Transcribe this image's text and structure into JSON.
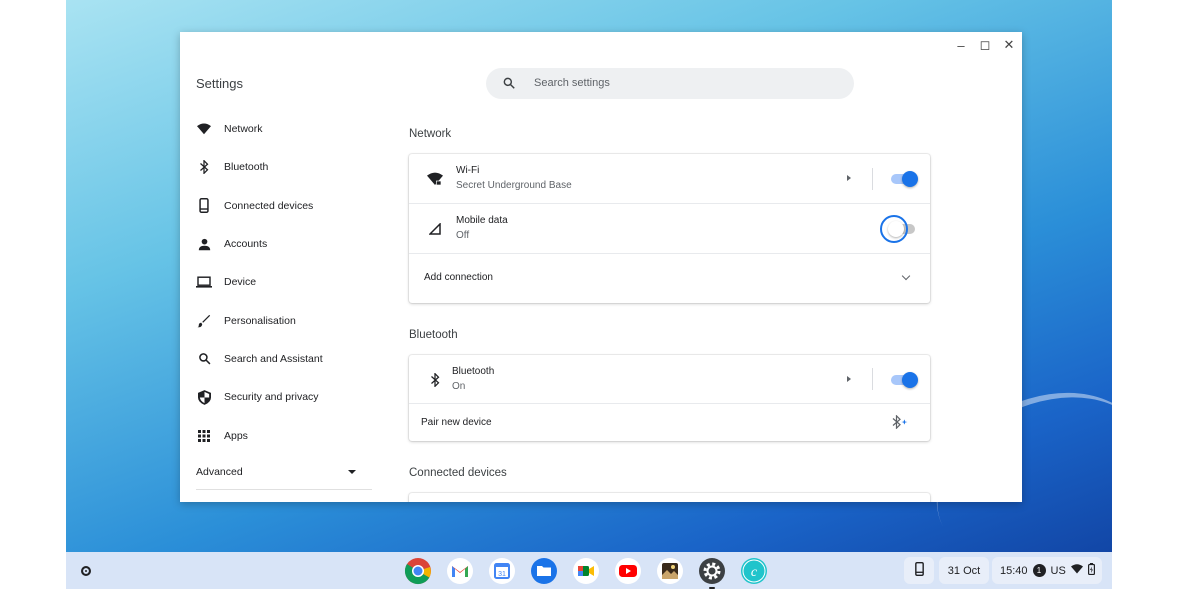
{
  "window": {
    "title": "Settings",
    "search_placeholder": "Search settings"
  },
  "sidebar": {
    "items": [
      {
        "label": "Network",
        "icon": "wifi-icon"
      },
      {
        "label": "Bluetooth",
        "icon": "bluetooth-icon"
      },
      {
        "label": "Connected devices",
        "icon": "phone-icon"
      },
      {
        "label": "Accounts",
        "icon": "person-icon"
      },
      {
        "label": "Device",
        "icon": "laptop-icon"
      },
      {
        "label": "Personalisation",
        "icon": "brush-icon"
      },
      {
        "label": "Search and Assistant",
        "icon": "search-icon"
      },
      {
        "label": "Security and privacy",
        "icon": "shield-icon"
      },
      {
        "label": "Apps",
        "icon": "apps-grid-icon"
      }
    ],
    "advanced_label": "Advanced"
  },
  "network": {
    "section_title": "Network",
    "wifi": {
      "title": "Wi-Fi",
      "subtitle": "Secret Underground Base",
      "enabled": true
    },
    "mobile": {
      "title": "Mobile data",
      "subtitle": "Off",
      "enabled": false
    },
    "add_connection_label": "Add connection"
  },
  "bluetooth": {
    "section_title": "Bluetooth",
    "row": {
      "title": "Bluetooth",
      "subtitle": "On",
      "enabled": true
    },
    "pair_label": "Pair new device"
  },
  "connected_devices": {
    "section_title": "Connected devices"
  },
  "shelf": {
    "apps": [
      "chrome-icon",
      "gmail-icon",
      "calendar-icon",
      "files-icon",
      "meet-icon",
      "youtube-icon",
      "photo-app-icon",
      "settings-icon",
      "canva-icon"
    ],
    "date": "31 Oct",
    "time": "15:40",
    "notification_count": "1",
    "ime": "US"
  },
  "colors": {
    "accent": "#1a73e8",
    "shelf": "#d8e4f7"
  }
}
